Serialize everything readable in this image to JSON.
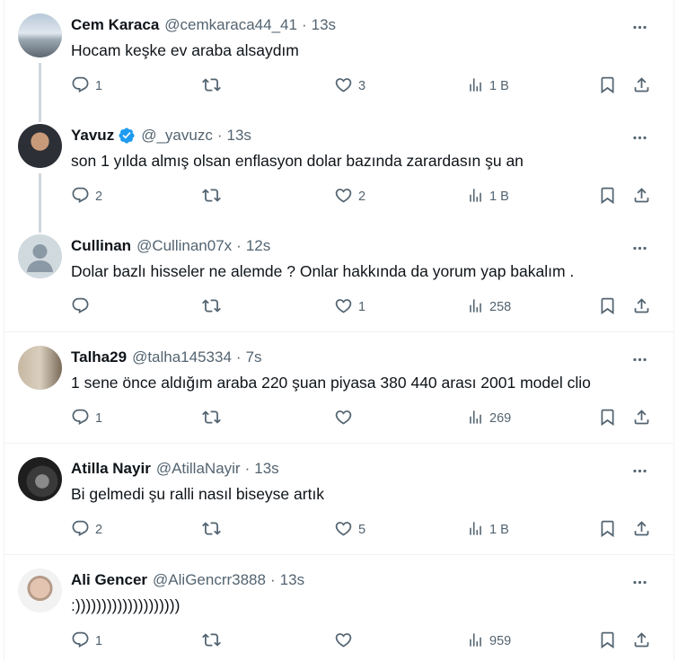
{
  "tweets": [
    {
      "name": "Cem Karaca",
      "handle": "@cemkaraca44_41",
      "sep": "·",
      "time": "13s",
      "text": "Hocam keşke ev araba alsaydım",
      "replies": "1",
      "retweets": "",
      "likes": "3",
      "views": "1 B",
      "verified": false
    },
    {
      "name": "Yavuz",
      "handle": "@_yavuzc",
      "sep": "·",
      "time": "13s",
      "text": "son 1 yılda almış olsan enflasyon dolar bazında zarardasın şu an",
      "replies": "2",
      "retweets": "",
      "likes": "2",
      "views": "1 B",
      "verified": true
    },
    {
      "name": "Cullinan",
      "handle": "@Cullinan07x",
      "sep": "·",
      "time": "12s",
      "text": "Dolar bazlı hisseler ne alemde ? Onlar hakkında da yorum yap bakalım .",
      "replies": "",
      "retweets": "",
      "likes": "1",
      "views": "258",
      "verified": false
    },
    {
      "name": "Talha29",
      "handle": "@talha145334",
      "sep": "·",
      "time": "7s",
      "text": "1 sene önce aldığım araba 220 şuan piyasa 380 440 arası 2001 model clio",
      "replies": "1",
      "retweets": "",
      "likes": "",
      "views": "269",
      "verified": false
    },
    {
      "name": "Atilla Nayir",
      "handle": "@AtillaNayir",
      "sep": "·",
      "time": "13s",
      "text": "Bi gelmedi şu ralli nasıl biseyse artık",
      "replies": "2",
      "retweets": "",
      "likes": "5",
      "views": "1 B",
      "verified": false
    },
    {
      "name": "Ali Gencer",
      "handle": "@AliGencrr3888",
      "sep": "·",
      "time": "13s",
      "text": ":))))))))))))))))))))",
      "replies": "1",
      "retweets": "",
      "likes": "",
      "views": "959",
      "verified": false
    }
  ],
  "colors": {
    "text": "#0f1419",
    "secondary": "#536471",
    "verified": "#1d9bf0",
    "divider": "#eff3f4",
    "thread_line": "#cfd9de"
  },
  "icons": [
    "reply-icon",
    "retweet-icon",
    "like-icon",
    "views-icon",
    "bookmark-icon",
    "share-icon",
    "more-icon",
    "verified-badge-icon"
  ]
}
